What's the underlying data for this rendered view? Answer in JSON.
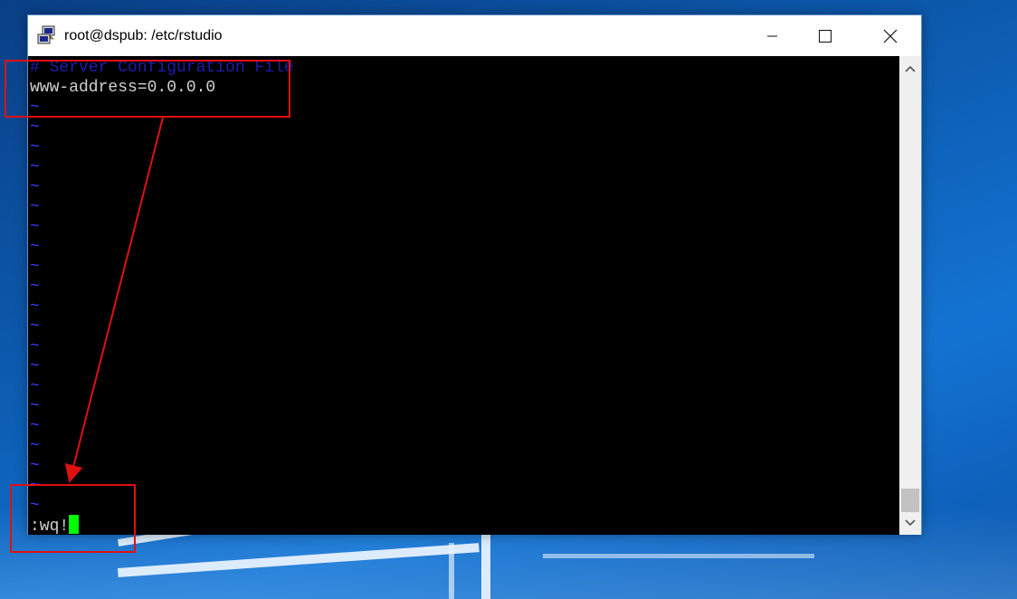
{
  "window": {
    "title": "root@dspub: /etc/rstudio",
    "icon": "putty-icon",
    "buttons": {
      "minimize": "—",
      "maximize": "☐",
      "close": "✕"
    }
  },
  "terminal": {
    "comment_line": "# Server Configuration File",
    "config_line": "www-address=0.0.0.0",
    "empty_marker": "~",
    "command_line": ":wq!"
  },
  "scrollbar": {
    "up": "▲",
    "down": "▼"
  },
  "colors": {
    "comment": "#1d1db0",
    "tilde": "#3c3cff",
    "cursor": "#00ff00",
    "annotation": "#e01010"
  }
}
